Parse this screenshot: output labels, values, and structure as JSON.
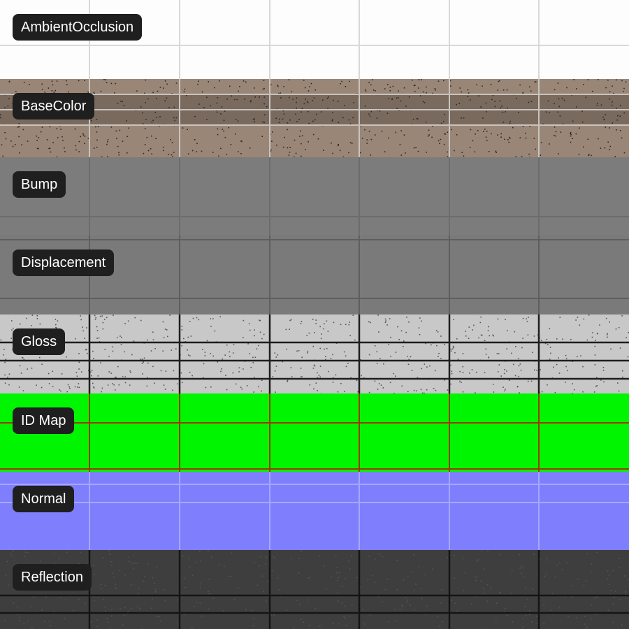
{
  "maps": [
    {
      "name": "AmbientOcclusion",
      "base": "#fdfdfd",
      "line": "#d8d8d8",
      "grain": "#e6e6e6",
      "grain_density": 0.0
    },
    {
      "name": "BaseColor",
      "base": "#9a8677",
      "alt": "#7a6a5e",
      "line": "#c8c4be",
      "grain": "#2e2724",
      "grain_density": 1.0
    },
    {
      "name": "Bump",
      "base": "#7c7c7c",
      "line": "#6c6c6c",
      "grain": "#747474",
      "grain_density": 0.0
    },
    {
      "name": "Displacement",
      "base": "#7a7a7a",
      "line": "#5e5e5e",
      "grain": "#727272",
      "grain_density": 0.0
    },
    {
      "name": "Gloss",
      "base": "#c8c8c8",
      "line": "#1e1e1e",
      "grain": "#555555",
      "grain_density": 0.9
    },
    {
      "name": "ID Map",
      "base": "#00f500",
      "line": "#9a3a00",
      "grain": "#22c022",
      "grain_density": 0.0
    },
    {
      "name": "Normal",
      "base": "#7f7ffe",
      "line": "#a6a6ff",
      "grain": "#6e6ef0",
      "grain_density": 0.0
    },
    {
      "name": "Reflection",
      "base": "#3e3e3e",
      "line": "#151515",
      "grain": "#555555",
      "grain_density": 0.6
    }
  ]
}
